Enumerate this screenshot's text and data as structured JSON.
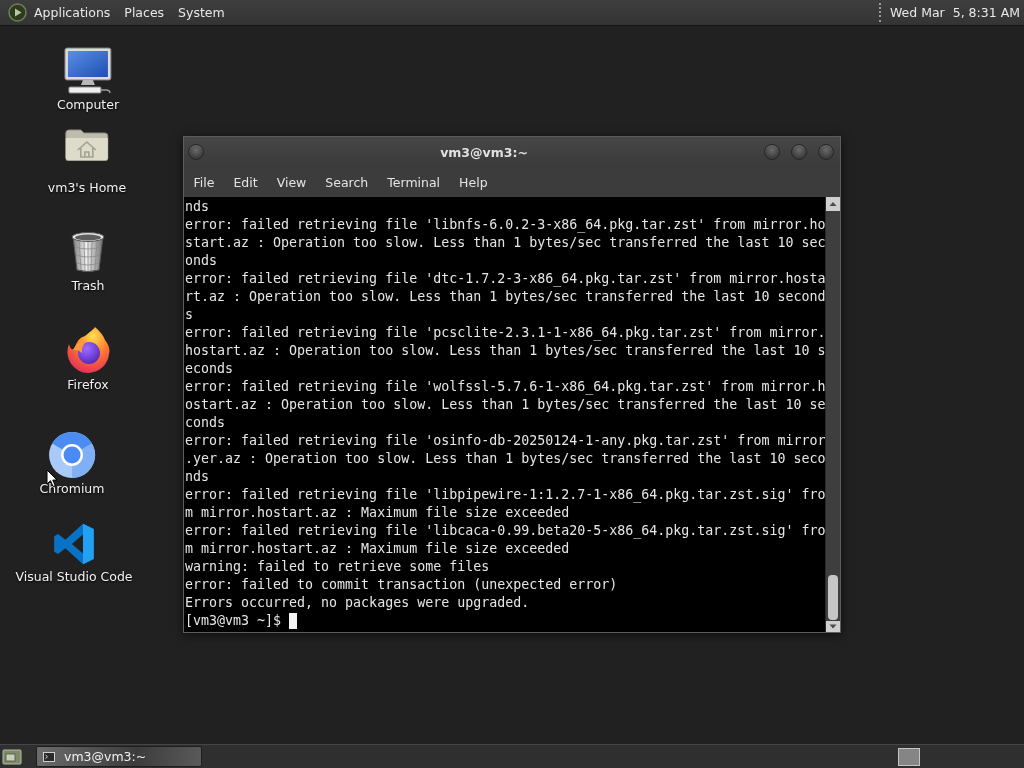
{
  "top_panel": {
    "menus": [
      "Applications",
      "Places",
      "System"
    ],
    "clock": "Wed Mar  5, 8:31 AM"
  },
  "desktop_icons": [
    {
      "kind": "computer",
      "label": "Computer"
    },
    {
      "kind": "home",
      "label": "vm3's Home"
    },
    {
      "kind": "trash",
      "label": "Trash"
    },
    {
      "kind": "firefox",
      "label": "Firefox"
    },
    {
      "kind": "chromium",
      "label": "Chromium"
    },
    {
      "kind": "vscode",
      "label": "Visual Studio Code"
    }
  ],
  "terminal_window": {
    "title": "vm3@vm3:~",
    "menu": [
      "File",
      "Edit",
      "View",
      "Search",
      "Terminal",
      "Help"
    ],
    "lines": [
      "nds",
      "error: failed retrieving file 'libnfs-6.0.2-3-x86_64.pkg.tar.zst' from mirror.ho",
      "start.az : Operation too slow. Less than 1 bytes/sec transferred the last 10 sec",
      "onds",
      "error: failed retrieving file 'dtc-1.7.2-3-x86_64.pkg.tar.zst' from mirror.hosta",
      "rt.az : Operation too slow. Less than 1 bytes/sec transferred the last 10 second",
      "s",
      "error: failed retrieving file 'pcsclite-2.3.1-1-x86_64.pkg.tar.zst' from mirror.",
      "hostart.az : Operation too slow. Less than 1 bytes/sec transferred the last 10 s",
      "econds",
      "error: failed retrieving file 'wolfssl-5.7.6-1-x86_64.pkg.tar.zst' from mirror.h",
      "ostart.az : Operation too slow. Less than 1 bytes/sec transferred the last 10 se",
      "conds",
      "error: failed retrieving file 'osinfo-db-20250124-1-any.pkg.tar.zst' from mirror",
      ".yer.az : Operation too slow. Less than 1 bytes/sec transferred the last 10 seco",
      "nds",
      "error: failed retrieving file 'libpipewire-1:1.2.7-1-x86_64.pkg.tar.zst.sig' fro",
      "m mirror.hostart.az : Maximum file size exceeded",
      "error: failed retrieving file 'libcaca-0.99.beta20-5-x86_64.pkg.tar.zst.sig' fro",
      "m mirror.hostart.az : Maximum file size exceeded",
      "warning: failed to retrieve some files",
      "error: failed to commit transaction (unexpected error)",
      "Errors occurred, no packages were upgraded."
    ],
    "prompt": "[vm3@vm3 ~]$"
  },
  "taskbar": {
    "windows": [
      {
        "title": "vm3@vm3:~"
      }
    ]
  }
}
